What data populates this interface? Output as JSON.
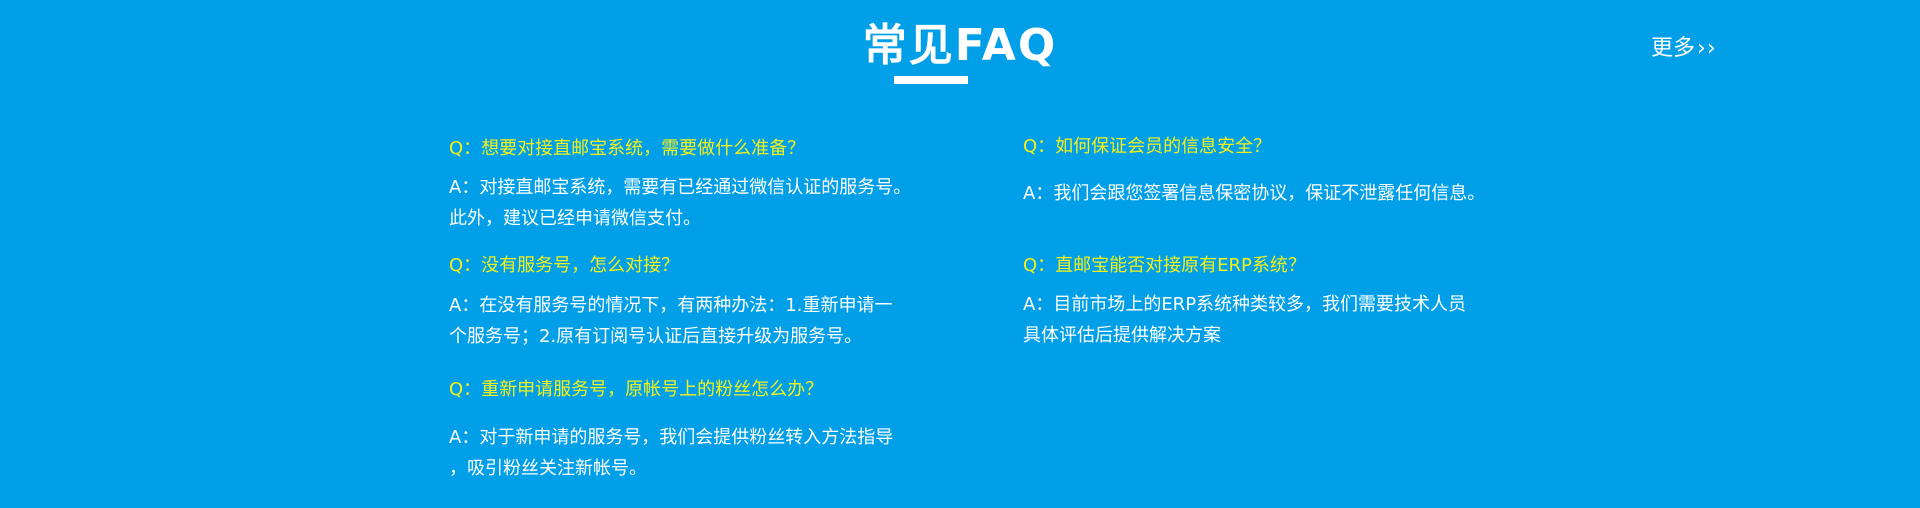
{
  "header": {
    "title": "常见FAQ",
    "more_label": "更多",
    "more_chevrons": "››"
  },
  "faq": {
    "left": [
      {
        "question": "Q：想要对接直邮宝系统，需要做什么准备？",
        "answer_lines": [
          "A：对接直邮宝系统，需要有已经通过微信认证的服务号。",
          "此外，建议已经申请微信支付。"
        ]
      },
      {
        "question": "Q：没有服务号，怎么对接？",
        "answer_lines": [
          "A：在没有服务号的情况下，有两种办法：1.重新申请一",
          "个服务号；2.原有订阅号认证后直接升级为服务号。"
        ]
      },
      {
        "question": "Q：重新申请服务号，原帐号上的粉丝怎么办？",
        "answer_lines": [
          "A：对于新申请的服务号，我们会提供粉丝转入方法指导",
          "，吸引粉丝关注新帐号。"
        ]
      }
    ],
    "right": [
      {
        "question": "Q：如何保证会员的信息安全？",
        "answer_lines": [
          "A：我们会跟您签署信息保密协议，保证不泄露任何信息。"
        ]
      },
      {
        "question": "Q：直邮宝能否对接原有ERP系统？",
        "answer_lines": [
          "A：目前市场上的ERP系统种类较多，我们需要技术人员",
          "具体评估后提供解决方案"
        ]
      }
    ]
  },
  "colors": {
    "background": "#019fe8",
    "question": "#f2f21a",
    "text": "#ffffff"
  }
}
